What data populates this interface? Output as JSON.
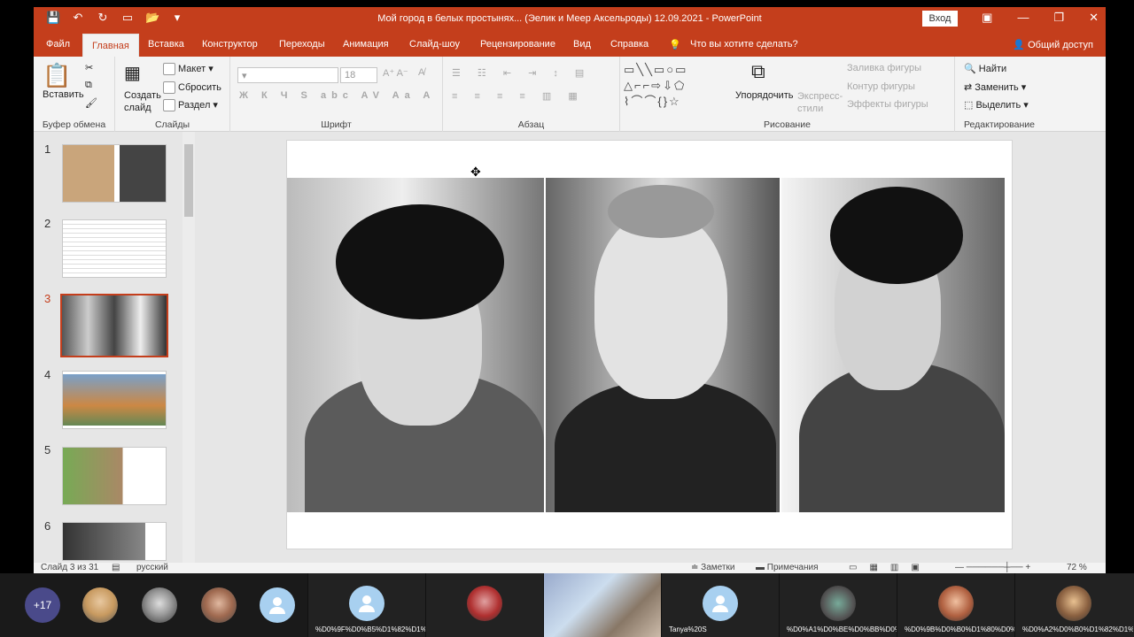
{
  "window": {
    "title": "Мой город в белых простынях... (Эелик и Меер Аксельроды) 12.09.2021 - PowerPoint",
    "signin": "Вход"
  },
  "tabs": [
    "Файл",
    "Главная",
    "Вставка",
    "Конструктор",
    "Переходы",
    "Анимация",
    "Слайд-шоу",
    "Рецензирование",
    "Вид",
    "Справка"
  ],
  "tell_me": "Что вы хотите сделать?",
  "share": "Общий доступ",
  "ribbon": {
    "clipboard": {
      "paste": "Вставить",
      "label": "Буфер обмена"
    },
    "slides": {
      "new_slide": "Создать слайд",
      "layout": "Макет",
      "reset": "Сбросить",
      "section": "Раздел",
      "label": "Слайды"
    },
    "font": {
      "size": "18",
      "label": "Шрифт"
    },
    "paragraph": {
      "label": "Абзац"
    },
    "drawing": {
      "arrange": "Упорядочить",
      "quick_styles": "Экспресс-стили",
      "fill": "Заливка фигуры",
      "outline": "Контур фигуры",
      "effects": "Эффекты фигуры",
      "label": "Рисование"
    },
    "editing": {
      "find": "Найти",
      "replace": "Заменить",
      "select": "Выделить",
      "label": "Редактирование"
    }
  },
  "slides": [
    {
      "num": "1"
    },
    {
      "num": "2"
    },
    {
      "num": "3"
    },
    {
      "num": "4"
    },
    {
      "num": "5"
    },
    {
      "num": "6"
    }
  ],
  "status": {
    "slide_info": "Слайд 3 из 31",
    "language": "русский",
    "notes": "Заметки",
    "comments": "Примечания",
    "zoom": "72 %"
  },
  "call": {
    "more_count": "+17",
    "names": [
      "%D0%9F%D0%B5%D1%82%D1%80...",
      "Tanya%20S",
      "%D0%A1%D0%BE%D0%BB%D0%BE%D0%B...",
      "%D0%9B%D0%B0%D1%80%D0%B8%D1%81...",
      "%D0%A2%D0%B0%D1%82%D1%8C..."
    ]
  }
}
